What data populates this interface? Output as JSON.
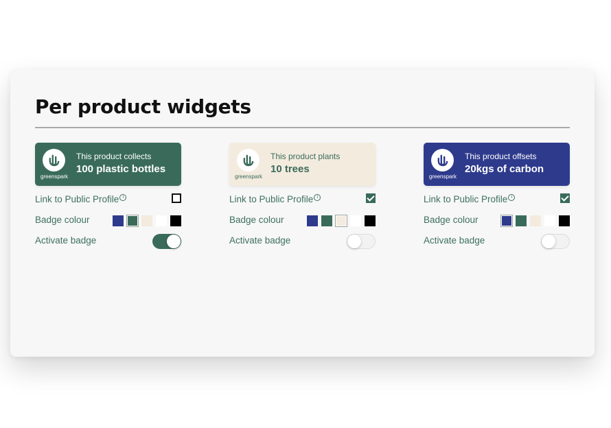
{
  "page": {
    "title": "Per product widgets"
  },
  "labels": {
    "link": "Link to Public Profile",
    "info": "i",
    "colour": "Badge colour",
    "activate": "Activate badge",
    "logo": "greenspark"
  },
  "swatch_colors": [
    "#2e3a8c",
    "#3a6b5a",
    "#f3ebde",
    "#ffffff",
    "#000000"
  ],
  "widgets": [
    {
      "top": "This product collects",
      "main": "100 plastic bottles",
      "bg": "#3a6b5a",
      "fg": "#ffffff",
      "logo_fg": "#3a6b5a",
      "link_checked": false,
      "selected_color": 1,
      "active": true
    },
    {
      "top": "This product plants",
      "main": "10 trees",
      "bg": "#f3ebde",
      "fg": "#3a6b5a",
      "logo_fg": "#3a6b5a",
      "link_checked": true,
      "selected_color": 2,
      "active": false
    },
    {
      "top": "This product offsets",
      "main": "20kgs of carbon",
      "bg": "#2e3a8c",
      "fg": "#ffffff",
      "logo_fg": "#2e3a8c",
      "link_checked": true,
      "selected_color": 0,
      "active": false
    }
  ]
}
